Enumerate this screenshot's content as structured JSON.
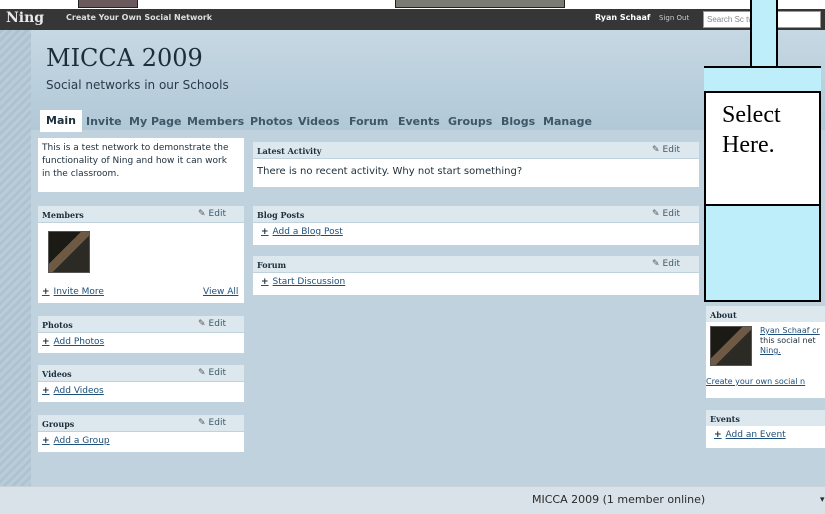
{
  "topbar": {
    "logo": "Ning",
    "create_link": "Create Your Own Social Network",
    "user_name": "Ryan Schaaf",
    "sign_out": "Sign Out",
    "search_placeholder": "Search Sc      twork"
  },
  "header": {
    "title": "MICCA 2009",
    "tagline": "Social networks in our Schools"
  },
  "nav": {
    "tabs": [
      "Main",
      "Invite",
      "My Page",
      "Members",
      "Photos",
      "Videos",
      "Forum",
      "Events",
      "Groups",
      "Blogs",
      "Manage"
    ],
    "active": "Main"
  },
  "edit_label": "Edit",
  "left": {
    "description": [
      "This is a test network to demonstrate the",
      "functionality of Ning and how it can work",
      "in the classroom."
    ],
    "members": {
      "title": "Members",
      "invite_more": "Invite More",
      "view_all": "View All"
    },
    "photos": {
      "title": "Photos",
      "add": "Add Photos"
    },
    "videos": {
      "title": "Videos",
      "add": "Add Videos"
    },
    "groups": {
      "title": "Groups",
      "add": "Add a Group"
    }
  },
  "center": {
    "latest": {
      "title": "Latest Activity",
      "text": "There is no recent activity. Why not start something?"
    },
    "blog": {
      "title": "Blog Posts",
      "add": "Add a Blog Post"
    },
    "forum": {
      "title": "Forum",
      "add": "Start Discussion"
    }
  },
  "right": {
    "about": {
      "title": "About",
      "line1": "Ryan Schaaf cr",
      "line2": "this social net",
      "line3": "Ning.",
      "create": "Create your own social n"
    },
    "events": {
      "title": "Events",
      "add": "Add an Event"
    }
  },
  "footer": {
    "text": "MICCA 2009 (1 member online)"
  },
  "callout": {
    "line1": "Select",
    "line2": "Here."
  }
}
